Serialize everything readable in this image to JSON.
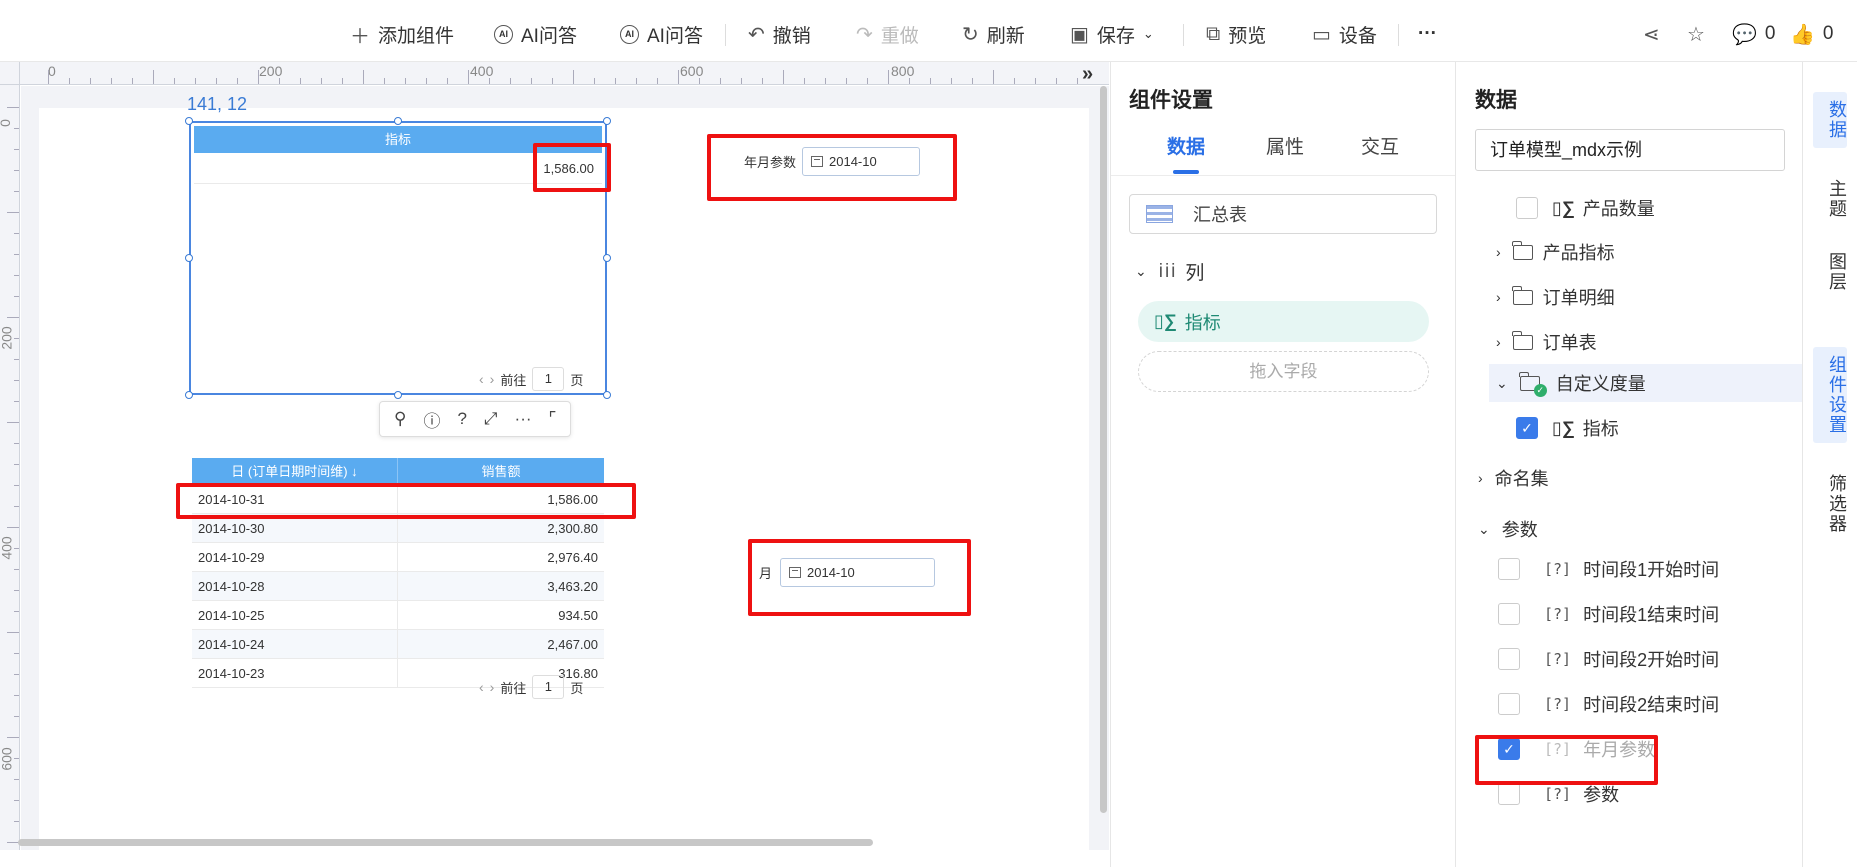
{
  "toolbar": {
    "add_component": "添加组件",
    "ai_qa_1": "AI问答",
    "ai_qa_2": "AI问答",
    "undo": "撤销",
    "redo": "重做",
    "refresh": "刷新",
    "save": "保存",
    "preview": "预览",
    "device": "设备",
    "more": "···",
    "comments_count": "0",
    "likes_count": "0"
  },
  "ruler": {
    "h_labels": [
      "0",
      "200",
      "400",
      "600",
      "800"
    ],
    "v_labels": [
      "0",
      "200",
      "400",
      "600"
    ]
  },
  "canvas": {
    "coord_readout": "141, 12",
    "metric_table": {
      "header": "指标",
      "value": "1,586.00",
      "pager": {
        "prefix": "前往",
        "page": "1",
        "suffix": "页"
      }
    },
    "widget_toolbar_icons": [
      "filter-icon",
      "info-icon",
      "help-icon",
      "expand-icon",
      "more-icon",
      "fullscreen-icon"
    ],
    "param_year_month": {
      "label": "年月参数",
      "value": "2014-10"
    },
    "param_month": {
      "label": "月",
      "value": "2014-10"
    },
    "detail_table": {
      "headers": [
        "日 (订单日期时间维) ↓",
        "销售额"
      ],
      "rows": [
        [
          "2014-10-31",
          "1,586.00"
        ],
        [
          "2014-10-30",
          "2,300.80"
        ],
        [
          "2014-10-29",
          "2,976.40"
        ],
        [
          "2014-10-28",
          "3,463.20"
        ],
        [
          "2014-10-25",
          "934.50"
        ],
        [
          "2014-10-24",
          "2,467.00"
        ],
        [
          "2014-10-23",
          "316.80"
        ]
      ],
      "pager": {
        "prefix": "前往",
        "page": "1",
        "suffix": "页"
      }
    }
  },
  "settings": {
    "title": "组件设置",
    "tabs": [
      "数据",
      "属性",
      "交互"
    ],
    "active_tab": "数据",
    "component_type": "汇总表",
    "column_section": "列",
    "column_field": "指标",
    "drop_hint": "拖入字段",
    "accent": "#2a6fe6"
  },
  "data_panel": {
    "title": "数据",
    "model": "订单模型_mdx示例",
    "items": [
      {
        "label": "产品数量",
        "type": "measure",
        "checked": false
      },
      {
        "label": "产品指标",
        "type": "folder"
      },
      {
        "label": "订单明细",
        "type": "folder"
      },
      {
        "label": "订单表",
        "type": "folder"
      },
      {
        "label": "自定义度量",
        "type": "folder-open"
      },
      {
        "label": "指标",
        "type": "measure",
        "checked": true
      }
    ],
    "named_set": "命名集",
    "params_section": "参数",
    "params": [
      {
        "label": "时间段1开始时间",
        "checked": false
      },
      {
        "label": "时间段1结束时间",
        "checked": false
      },
      {
        "label": "时间段2开始时间",
        "checked": false
      },
      {
        "label": "时间段2结束时间",
        "checked": false
      },
      {
        "label": "年月参数",
        "checked": true
      },
      {
        "label": "参数",
        "checked": false
      }
    ]
  },
  "side_rail": [
    "数据",
    "主题",
    "图层",
    "组件设置",
    "筛选器"
  ]
}
